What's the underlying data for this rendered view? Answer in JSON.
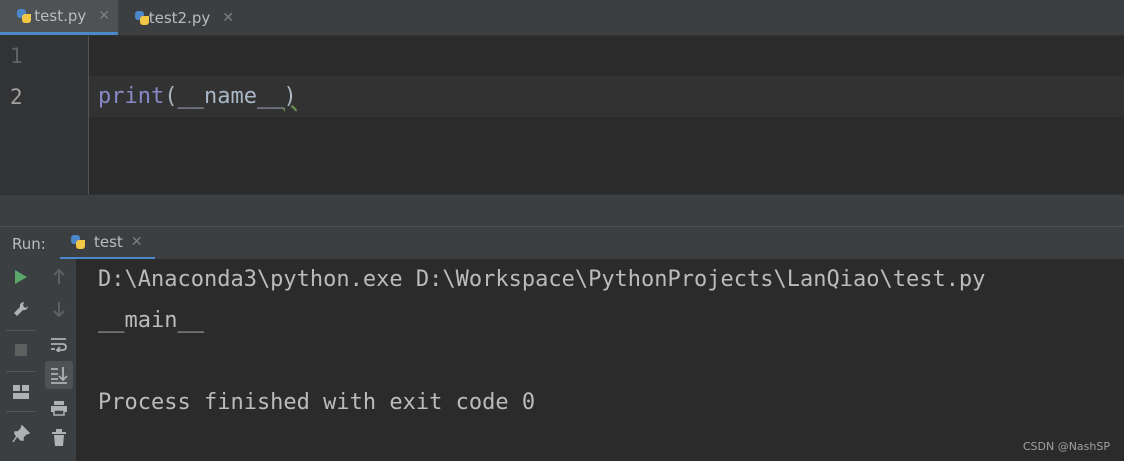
{
  "tabs": [
    {
      "label": "test.py",
      "icon": "python-file-icon",
      "active": true
    },
    {
      "label": "test2.py",
      "icon": "python-file-icon",
      "active": false
    }
  ],
  "editor": {
    "line_numbers": [
      "1",
      "2"
    ],
    "code_line2": {
      "func": "print",
      "open": "(",
      "arg": "__name__",
      "close": ")"
    }
  },
  "run": {
    "label": "Run:",
    "tab_label": "test",
    "output": [
      "D:\\Anaconda3\\python.exe D:\\Workspace\\PythonProjects\\LanQiao\\test.py",
      "__main__",
      "",
      "Process finished with exit code 0"
    ]
  },
  "watermark": "CSDN @NashSP",
  "colors": {
    "accent": "#4a88c7",
    "run_green": "#59a869",
    "builtin": "#8888c6"
  }
}
